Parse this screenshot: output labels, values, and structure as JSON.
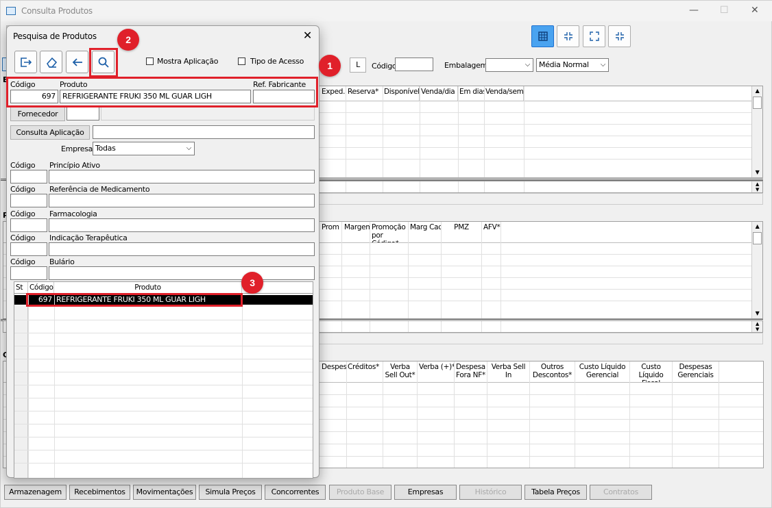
{
  "window": {
    "title": "Consulta Produtos"
  },
  "main": {
    "l_button": "L",
    "codigo_label": "Código",
    "embalagem_label": "Embalagem",
    "media_select": "Média Normal",
    "grid1_headers": [
      "Exped.",
      "Reserva*",
      "Disponível",
      "Venda/dia",
      "Em dias",
      "Venda/sem"
    ],
    "grid2_headers": [
      "Prom",
      "Margem",
      "Promoção por Código*",
      "Marg Cad",
      "PMZ",
      "AFV*"
    ],
    "grid3_headers": [
      "Despesa N",
      "Créditos*",
      "Verba Sell Out*",
      "Verba (+)*",
      "Despesa Fora NF*",
      "Verba Sell In",
      "Outros Descontos*",
      "Custo Líquido Gerencial",
      "Custo Líquido Fiscal",
      "Despesas Gerenciais"
    ],
    "left_letters": [
      "E",
      "P",
      "C"
    ]
  },
  "tabs": [
    {
      "label": "Armazenagem",
      "enabled": true
    },
    {
      "label": "Recebimentos",
      "enabled": true
    },
    {
      "label": "Movimentações",
      "enabled": true
    },
    {
      "label": "Simula Preços",
      "enabled": true
    },
    {
      "label": "Concorrentes",
      "enabled": true
    },
    {
      "label": "Produto Base",
      "enabled": false
    },
    {
      "label": "Empresas",
      "enabled": true
    },
    {
      "label": "Histórico",
      "enabled": false
    },
    {
      "label": "Tabela Preços",
      "enabled": true
    },
    {
      "label": "Contratos",
      "enabled": false
    }
  ],
  "dialog": {
    "title": "Pesquisa de Produtos",
    "mostra_aplicacao": "Mostra Aplicação",
    "tipo_acesso": "Tipo de Acesso",
    "codigo_label": "Código",
    "produto_label": "Produto",
    "ref_fabricante_label": "Ref. Fabricante",
    "codigo_value": "697",
    "produto_value": "REFRIGERANTE FRUKI 350 ML GUAR LIGH",
    "fornecedor_button": "Fornecedor",
    "consulta_aplicacao_button": "Consulta Aplicação",
    "empresa_label": "Empresa",
    "empresa_value": "Todas",
    "sections": [
      {
        "codigo": "Código",
        "label": "Princípio Ativo"
      },
      {
        "codigo": "Código",
        "label": "Referência de Medicamento"
      },
      {
        "codigo": "Código",
        "label": "Farmacologia"
      },
      {
        "codigo": "Código",
        "label": "Indicação Terapêutica"
      },
      {
        "codigo": "Código",
        "label": "Bulário"
      }
    ],
    "results": {
      "headers": {
        "st": "St",
        "codigo": "Código",
        "produto": "Produto"
      },
      "rows": [
        {
          "codigo": "697",
          "produto": "REFRIGERANTE FRUKI 350 ML GUAR LIGH"
        }
      ]
    }
  },
  "annotations": [
    "1",
    "2",
    "3"
  ],
  "colors": {
    "accent": "#4aa3f0",
    "highlight": "#e0202a",
    "selected_row": "#000000"
  }
}
